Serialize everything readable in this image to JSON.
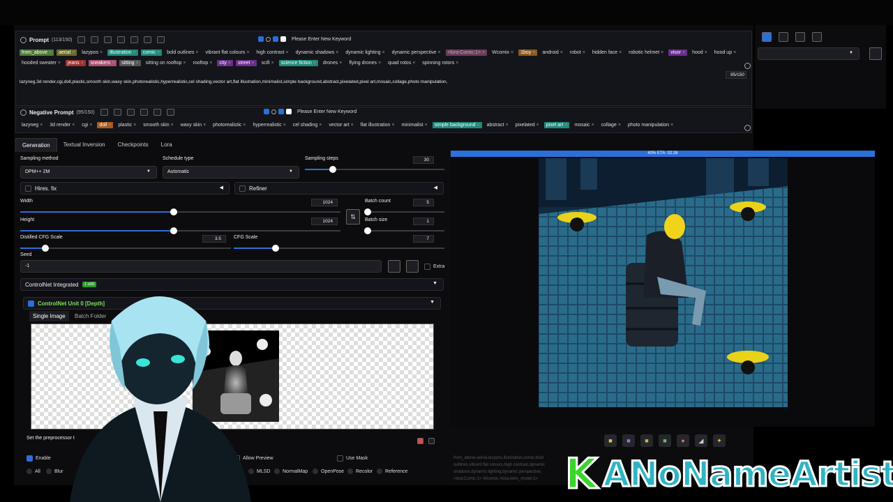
{
  "prompt": {
    "title": "Prompt",
    "count": "(113/150)",
    "keyword_placeholder": "Please Enter New Keyword",
    "tags_row1": [
      {
        "text": "from_above",
        "color": "c-green"
      },
      {
        "text": "aerial",
        "color": "c-olive"
      },
      {
        "text": "lazypos",
        "color": ""
      },
      {
        "text": "illustration",
        "color": "c-teal"
      },
      {
        "text": "comic",
        "color": "c-teal"
      },
      {
        "text": "bold outlines",
        "color": ""
      },
      {
        "text": "vibrant flat colours",
        "color": ""
      },
      {
        "text": "high contrast",
        "color": ""
      },
      {
        "text": "dynamic shadows",
        "color": ""
      },
      {
        "text": "dynamic lighting",
        "color": ""
      },
      {
        "text": "dynamic perspective",
        "color": ""
      },
      {
        "text": "<lora:Comic:1>",
        "color": "c-dim"
      },
      {
        "text": "Wcomix",
        "color": ""
      },
      {
        "text": "1boy",
        "color": "c-brown"
      },
      {
        "text": "android",
        "color": ""
      },
      {
        "text": "robot",
        "color": ""
      },
      {
        "text": "hidden face",
        "color": ""
      },
      {
        "text": "robotic helmet",
        "color": ""
      },
      {
        "text": "visor",
        "color": "c-purple"
      },
      {
        "text": "hood",
        "color": ""
      },
      {
        "text": "hood up",
        "color": ""
      }
    ],
    "tags_row2": [
      {
        "text": "hooded sweater",
        "color": ""
      },
      {
        "text": "jeans",
        "color": "c-red"
      },
      {
        "text": "sneakers",
        "color": "c-pink"
      },
      {
        "text": "sitting",
        "color": "c-gray"
      },
      {
        "text": "sitting on rooftop",
        "color": ""
      },
      {
        "text": "rooftop",
        "color": ""
      },
      {
        "text": "city",
        "color": "c-purple"
      },
      {
        "text": "street",
        "color": "c-purple"
      },
      {
        "text": "scifi",
        "color": ""
      },
      {
        "text": "science fiction",
        "color": "c-teal"
      },
      {
        "text": "drones",
        "color": ""
      },
      {
        "text": "flying drones",
        "color": ""
      },
      {
        "text": "quad rotos",
        "color": ""
      },
      {
        "text": "spinning rotors",
        "color": ""
      }
    ],
    "token_counter": "95/150"
  },
  "negative_prompt_text": "lazyneg,3d render,cgi,doll,plastic,smooth skin,waxy skin,photorealistic,hyperrealistic,cel shading,vector art,flat illustration,minimalist,simple background,abstract,pixelated,pixel art,mosaic,collage,photo manipulation,",
  "negative": {
    "title": "Negative Prompt",
    "count": "(95/150)",
    "keyword_placeholder": "Please Enter New Keyword",
    "tags": [
      {
        "text": "lazyneg",
        "color": ""
      },
      {
        "text": "3d render",
        "color": ""
      },
      {
        "text": "cgi",
        "color": ""
      },
      {
        "text": "doll",
        "color": "c-orange"
      },
      {
        "text": "plastic",
        "color": ""
      },
      {
        "text": "smooth skin",
        "color": ""
      },
      {
        "text": "waxy skin",
        "color": ""
      },
      {
        "text": "photorealistic",
        "color": ""
      },
      {
        "text": "hyperrealistic",
        "color": ""
      },
      {
        "text": "cel shading",
        "color": ""
      },
      {
        "text": "vector art",
        "color": ""
      },
      {
        "text": "flat illustration",
        "color": ""
      },
      {
        "text": "minimalist",
        "color": ""
      },
      {
        "text": "simple background",
        "color": "c-teal"
      },
      {
        "text": "abstract",
        "color": ""
      },
      {
        "text": "pixelated",
        "color": ""
      },
      {
        "text": "pixel art",
        "color": "c-teal"
      },
      {
        "text": "mosaic",
        "color": ""
      },
      {
        "text": "collage",
        "color": ""
      },
      {
        "text": "photo manipulation",
        "color": ""
      }
    ]
  },
  "tabs": [
    "Generation",
    "Textual Inversion",
    "Checkpoints",
    "Lora"
  ],
  "settings": {
    "sampling_method_label": "Sampling method",
    "sampling_method": "DPM++ 2M",
    "schedule_type_label": "Schedule type",
    "schedule_type": "Automatic",
    "sampling_steps_label": "Sampling steps",
    "sampling_steps": "30",
    "hires_fix": "Hires. fix",
    "refiner": "Refiner",
    "width_label": "Width",
    "width": "1024",
    "height_label": "Height",
    "height": "1024",
    "batch_count_label": "Batch count",
    "batch_count": "5",
    "batch_size_label": "Batch size",
    "batch_size": "1",
    "distilled_cfg_label": "Distilled CFG Scale",
    "distilled_cfg": "3.5",
    "cfg_label": "CFG Scale",
    "cfg": "7",
    "seed_label": "Seed",
    "seed": "-1",
    "extra": "Extra"
  },
  "levels": {
    "sampling_steps_fraction": 0.2,
    "width_fraction": 0.48,
    "height_fraction": 0.48,
    "batch_count_fraction": 0.0,
    "batch_size_fraction": 0.0,
    "distilled_cfg_fraction": 0.12,
    "cfg_fraction": 0.2
  },
  "controlnet": {
    "title": "ControlNet Integrated",
    "badge": "1 unit",
    "unit_title": "ControlNet Unit 0 [Depth]",
    "tab_single": "Single Image",
    "tab_batch": "Batch Folder",
    "preprocessor_note": "Set the preprocessor t",
    "enable": "Enable",
    "allow_preview": "Allow Preview",
    "use_mask": "Use Mask",
    "filters": [
      "All",
      "Blur",
      "rt",
      "MLSD",
      "NormalMap",
      "OpenPose",
      "Recolor",
      "Reference"
    ]
  },
  "progress": {
    "text": "40% ETA: 02:26",
    "fraction": 0.4
  },
  "info_text": "from_above,aerial,lazypos,illustration,comic,bold outlines,vibrant flat colours,high contrast,dynamic shadows,dynamic lighting,dynamic perspective,<lora:Comic:1> Wcomix,<lora:retro_model:1> outline,neon,1boy,android,robot,hidden face,robotic helmet,visor,hood,hood up,hooded sweater,jeans,sneakers,sitting on rooftop",
  "watermark": {
    "k": "K",
    "name": "ANoNameArtist"
  },
  "colors": {
    "accent": "#2b6fd8",
    "panel": "#0c0c0e",
    "green_badge": "#2d9a2a"
  }
}
